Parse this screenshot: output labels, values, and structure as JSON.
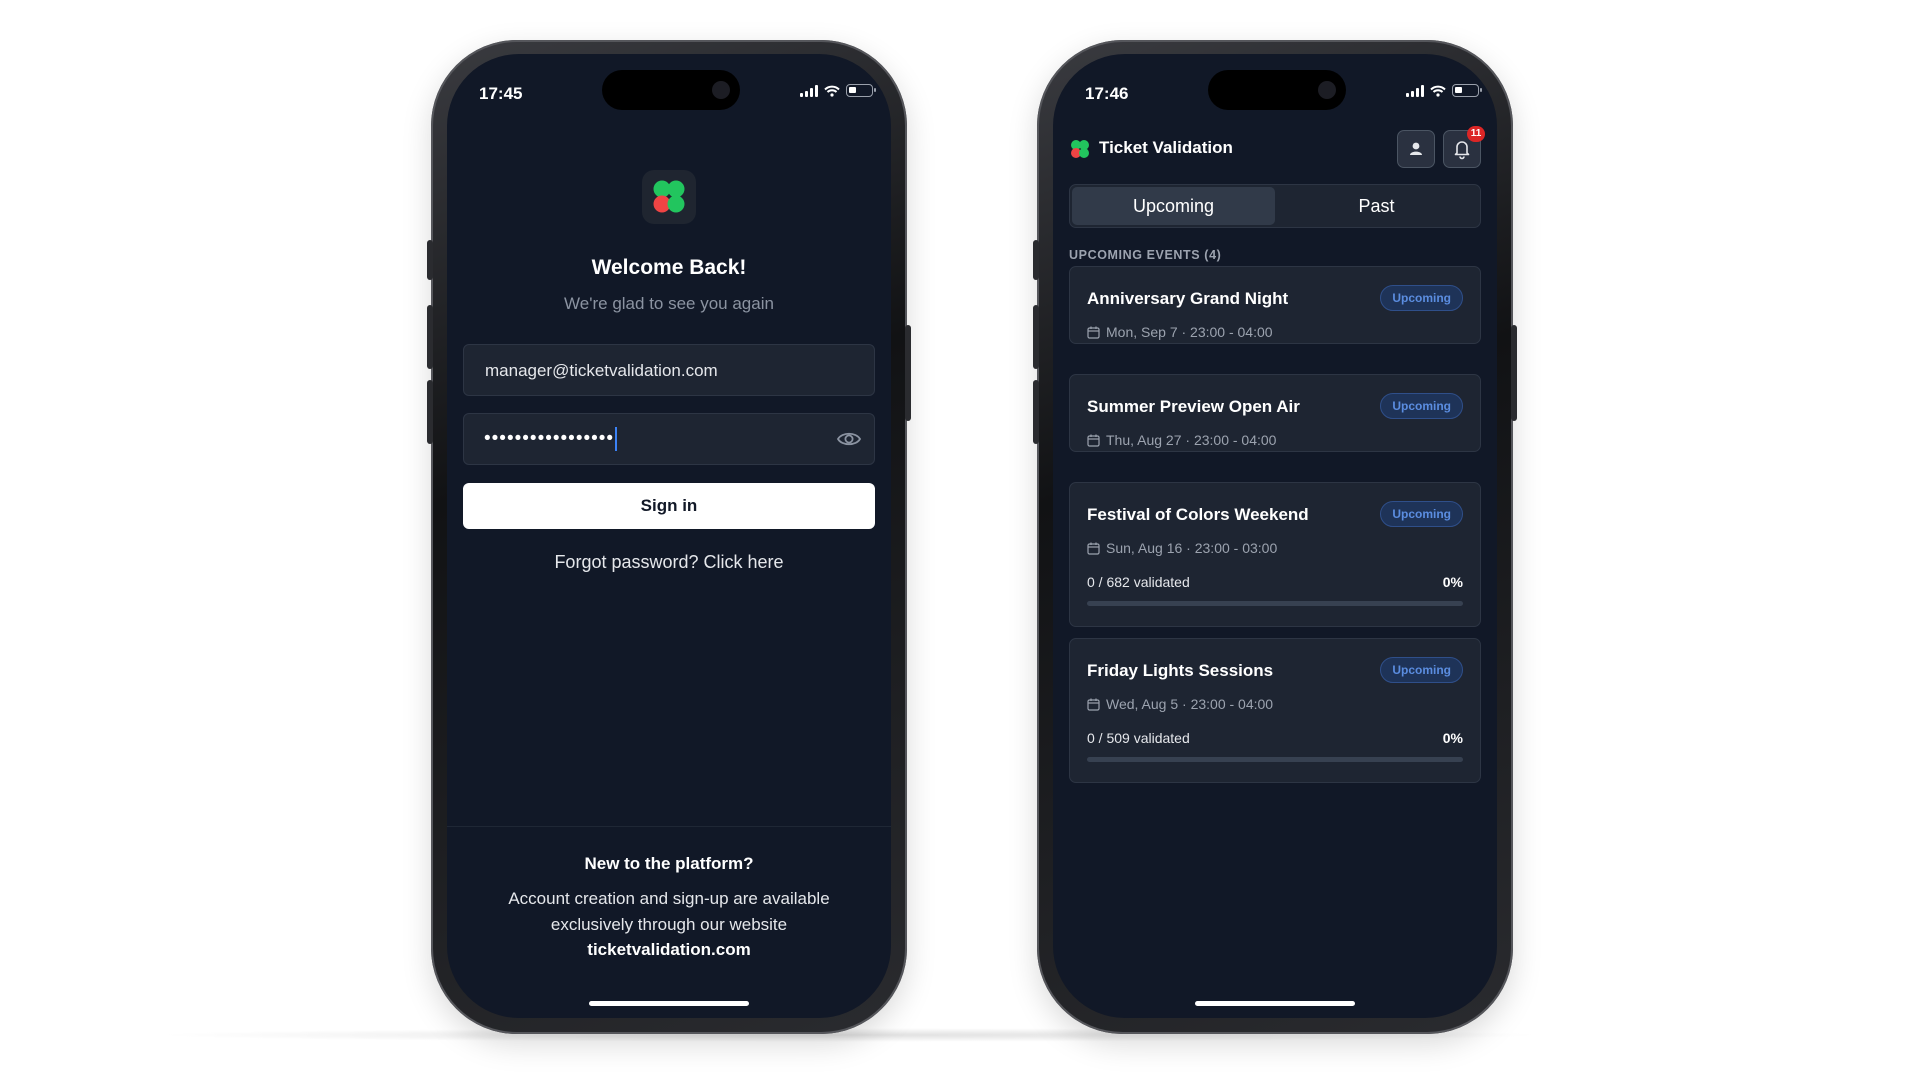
{
  "login_screen": {
    "status_time": "17:45",
    "welcome_title": "Welcome Back!",
    "welcome_subtitle": "We're glad to see you again",
    "email_value": "manager@ticketvalidation.com",
    "password_mask": "•••••••••••••••••",
    "signin_label": "Sign in",
    "forgot_label": "Forgot password? Click here",
    "new_title": "New to the platform?",
    "new_text": "Account creation and sign-up are available exclusively through our website",
    "website_link": "ticketvalidation.com"
  },
  "dashboard_screen": {
    "status_time": "17:46",
    "app_title": "Ticket Validation",
    "notification_count": "11",
    "tabs": [
      {
        "label": "Upcoming"
      },
      {
        "label": "Past"
      }
    ],
    "section_label": "UPCOMING EVENTS (4)",
    "events": [
      {
        "title": "Anniversary Grand Night",
        "badge": "Upcoming",
        "date": "Mon, Sep 7 · 23:00 - 04:00"
      },
      {
        "title": "Summer Preview Open Air",
        "badge": "Upcoming",
        "date": "Thu, Aug 27 · 23:00 - 04:00"
      },
      {
        "title": "Festival of Colors Weekend",
        "badge": "Upcoming",
        "date": "Sun, Aug 16 · 23:00 - 03:00",
        "validated": "0 / 682 validated",
        "percent": "0%",
        "progress": 0
      },
      {
        "title": "Friday Lights Sessions",
        "badge": "Upcoming",
        "date": "Wed, Aug 5 · 23:00 - 04:00",
        "validated": "0 / 509 validated",
        "percent": "0%",
        "progress": 0
      }
    ]
  },
  "colors": {
    "background": "#111827",
    "card": "#1e2532",
    "logo_green": "#22c55e",
    "logo_red": "#ef4444",
    "badge_blue": "#5b8de0",
    "notification_red": "#dc2626"
  },
  "icons": [
    "clover-logo-icon",
    "eye-icon",
    "user-icon",
    "bell-icon",
    "calendar-icon",
    "signal-icon",
    "wifi-icon",
    "battery-icon"
  ]
}
